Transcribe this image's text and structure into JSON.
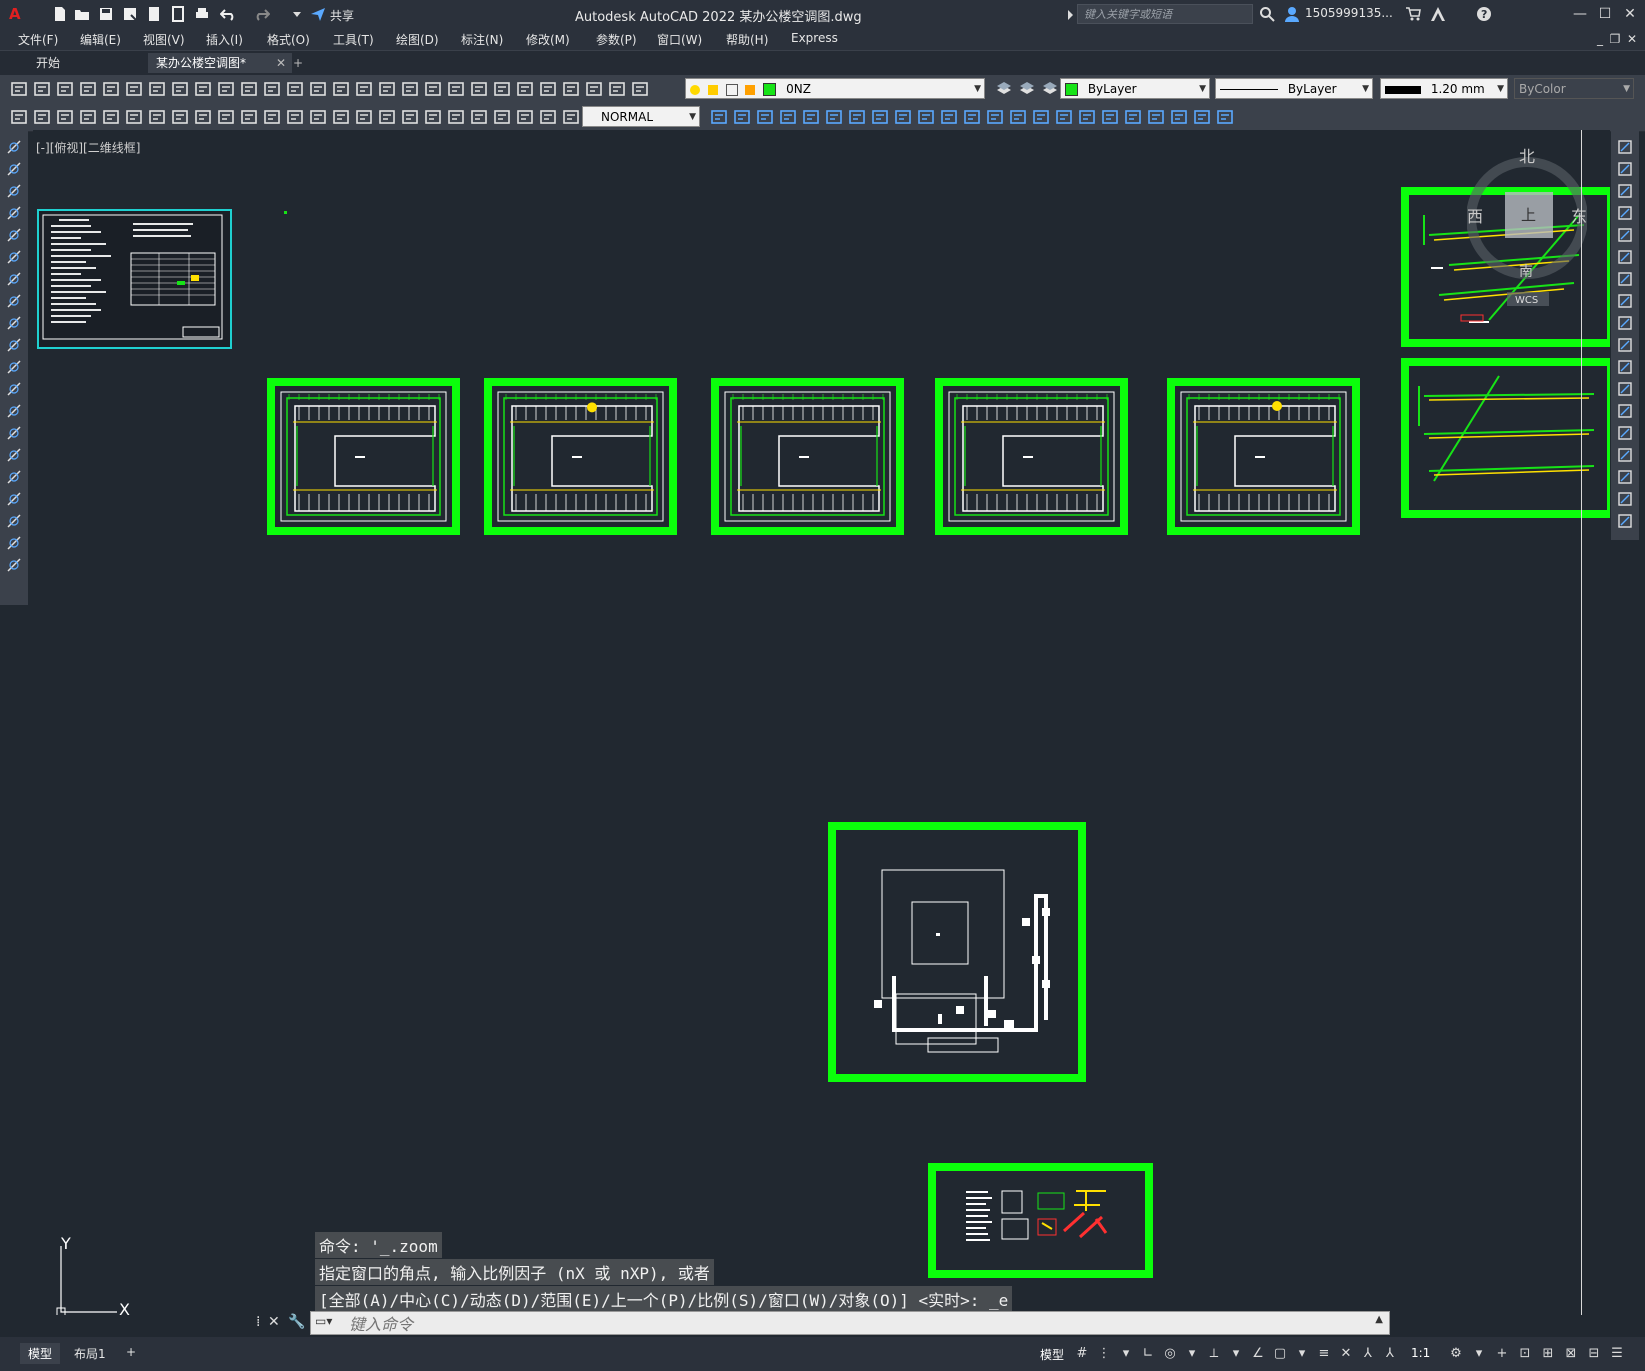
{
  "window": {
    "title": "Autodesk AutoCAD 2022    某办公楼空调图.dwg",
    "share_label": "共享",
    "search_placeholder": "键入关键字或短语",
    "user": "1505999135...",
    "minimize": "—",
    "maximize": "☐",
    "close": "✕"
  },
  "menu": {
    "items": [
      "文件(F)",
      "编辑(E)",
      "视图(V)",
      "插入(I)",
      "格式(O)",
      "工具(T)",
      "绘图(D)",
      "标注(N)",
      "修改(M)",
      "参数(P)",
      "窗口(W)",
      "帮助(H)",
      "Express"
    ]
  },
  "tabs": {
    "start": "开始",
    "doc": "某办公楼空调图*",
    "close": "✕",
    "add": "+"
  },
  "toolbar1": {
    "layer": "0NZ",
    "color": "ByLayer",
    "linetype": "ByLayer",
    "lineweight": "1.20 mm",
    "plotstyle": "ByColor"
  },
  "toolbar2": {
    "textstyle": "NORMAL"
  },
  "viewport": {
    "label": "[-][俯视][二维线框]"
  },
  "viewcube": {
    "north": "北",
    "west": "西",
    "east": "东",
    "south": "南",
    "top": "上",
    "wcs": "WCS"
  },
  "command": {
    "history": [
      "命令: '_.zoom",
      "指定窗口的角点, 输入比例因子 (nX 或 nXP), 或者",
      "[全部(A)/中心(C)/动态(D)/范围(E)/上一个(P)/比例(S)/窗口(W)/对象(O)] <实时>: _e"
    ],
    "placeholder": "键入命令"
  },
  "ucs": {
    "x": "X",
    "y": "Y"
  },
  "status": {
    "layouts": [
      "模型",
      "布局1"
    ],
    "add_layout": "+",
    "model_label": "模型",
    "scale": "1:1"
  },
  "colors": {
    "frame": "#0bff0b",
    "canvas": "#212830",
    "title_bg": "#2b313b",
    "toolbar_bg": "#3b414b"
  }
}
